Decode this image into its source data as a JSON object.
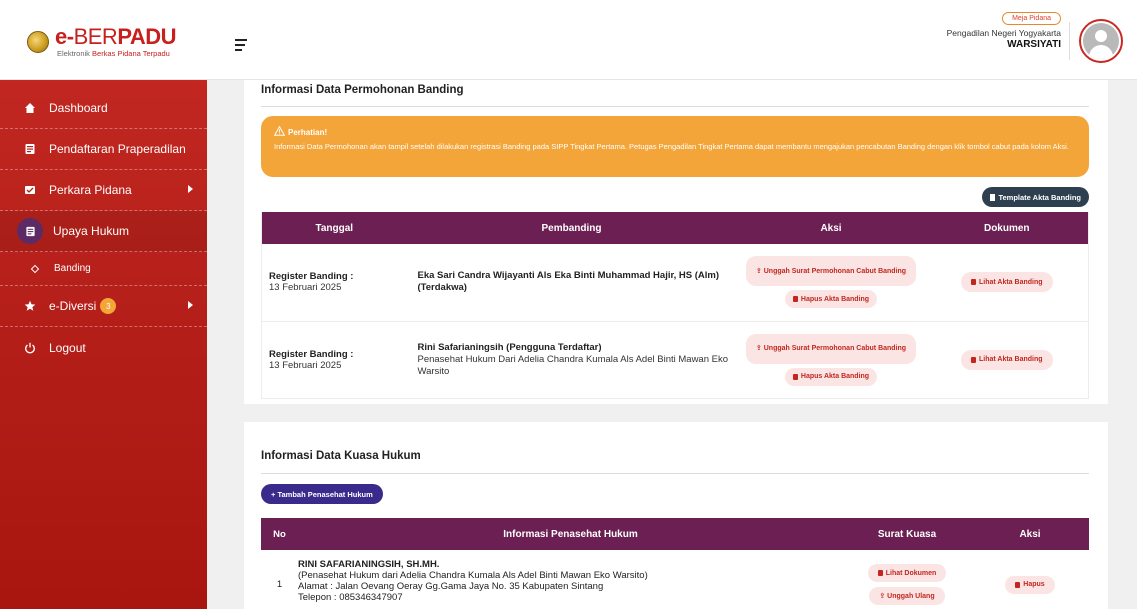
{
  "app": {
    "logo_prefix": "e-",
    "logo_main": "BER",
    "logo_accent": "PADU",
    "logo_sub_a": "Elektronik ",
    "logo_sub_b": "Berkas Pidana Terpadu"
  },
  "sidebar": {
    "items": [
      {
        "label": "Dashboard",
        "icon": "home-icon"
      },
      {
        "label": "Pendaftaran Praperadilan",
        "icon": "form-icon"
      },
      {
        "label": "Perkara Pidana",
        "icon": "case-icon"
      },
      {
        "label": "Upaya Hukum",
        "icon": "legal-icon"
      },
      {
        "label": "Banding",
        "icon": "diamond-icon"
      },
      {
        "label": "e-Diversi",
        "icon": "star-icon",
        "badge": "3"
      },
      {
        "label": "Logout",
        "icon": "power-icon"
      }
    ]
  },
  "topbar": {
    "role": "Meja Pidana",
    "court": "Pengadilan Negeri Yogyakarta",
    "user": "WARSIYATI"
  },
  "banding": {
    "title": "Informasi Data Permohonan Banding",
    "alert_title": "Perhatian!",
    "alert_text": "Informasi Data Permohonan akan tampil setelah dilakukan registrasi Banding pada SIPP Tingkat Pertama. Petugas Pengadilan Tingkat Pertama dapat membantu mengajukan pencabutan Banding dengan klik tombol cabut pada kolom Aksi.",
    "template_btn": "Template Akta Banding",
    "columns": [
      "Tanggal",
      "Pembanding",
      "Aksi",
      "Dokumen"
    ],
    "rows": [
      {
        "date_label": "Register Banding :",
        "date": "13 Februari 2025",
        "name": "Eka Sari Candra Wijayanti Als Eka Binti Muhammad Hajir, HS (Alm) (Terdakwa)",
        "sub": "",
        "upload_btn": "Unggah Surat Permohonan Cabut Banding",
        "delete_btn": "Hapus Akta Banding",
        "doc_btn": "Lihat Akta Banding"
      },
      {
        "date_label": "Register Banding :",
        "date": "13 Februari 2025",
        "name": "Rini Safarianingsih (Pengguna Terdaftar)",
        "sub": "Penasehat Hukum Dari Adelia Chandra Kumala Als Adel Binti Mawan Eko Warsito",
        "upload_btn": "Unggah Surat Permohonan Cabut Banding",
        "delete_btn": "Hapus Akta Banding",
        "doc_btn": "Lihat Akta Banding"
      }
    ]
  },
  "kuasa": {
    "title": "Informasi Data Kuasa Hukum",
    "add_btn": "+ Tambah Penasehat Hukum",
    "columns": [
      "No",
      "Informasi Penasehat Hukum",
      "Surat Kuasa",
      "Aksi"
    ],
    "rows": [
      {
        "no": "1",
        "name": "RINI SAFARIANINGSIH, SH.MH.",
        "line1": "(Penasehat Hukum dari Adelia Chandra Kumala Als Adel Binti Mawan Eko Warsito)",
        "line2": "Alamat : Jalan Oevang Oeray Gg.Gama Jaya No. 35 Kabupaten Sintang",
        "line3": "Telepon : 085346347907",
        "view_btn": "Lihat Dokumen",
        "reupload_btn": "Unggah Ulang",
        "delete_btn": "Hapus"
      }
    ]
  }
}
